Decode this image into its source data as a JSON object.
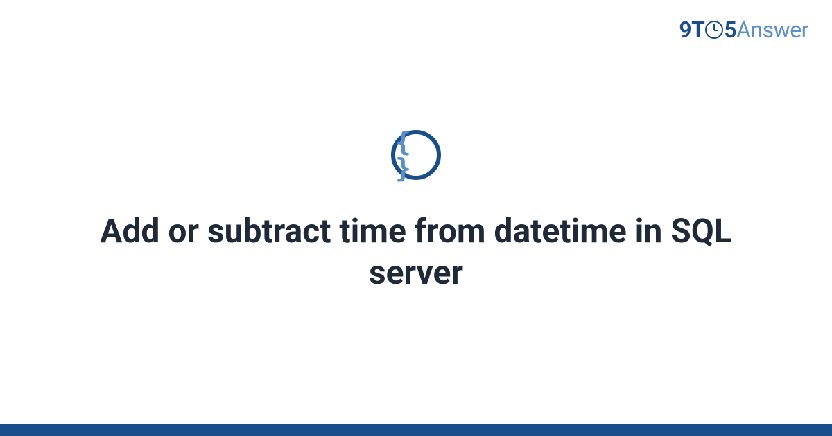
{
  "logo": {
    "part1": "9T",
    "part2": "5",
    "part3": "Answer"
  },
  "category": {
    "icon_symbol": "{ }",
    "icon_name": "code-braces"
  },
  "title": "Add or subtract time from datetime in SQL server",
  "colors": {
    "primary": "#1a4e8a",
    "secondary": "#5b8fc7",
    "text": "#1f2937"
  }
}
